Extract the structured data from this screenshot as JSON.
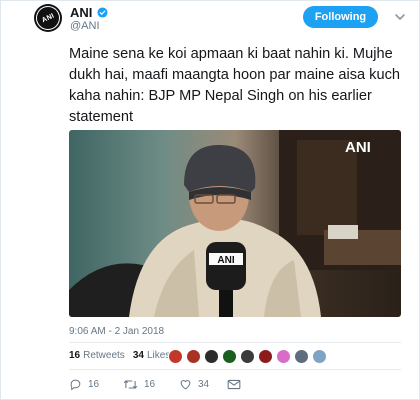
{
  "header": {
    "name": "ANI",
    "handle": "@ANI",
    "follow_label": "Following",
    "avatar_text": "ANI"
  },
  "tweet": {
    "text": "Maine sena ke koi apmaan ki baat nahin ki. Mujhe dukh hai, maafi maangta hoon par maine aisa kuch kaha nahin: BJP MP Nepal Singh on his earlier statement",
    "timestamp": "9:06 AM - 2 Jan 2018"
  },
  "media": {
    "watermark": "ANI",
    "mic_label": "ANI"
  },
  "stats": {
    "retweets_count": "16",
    "retweets_label": "Retweets",
    "likes_count": "34",
    "likes_label": "Likes"
  },
  "liker_avatar_colors": [
    "#c0392b",
    "#a93226",
    "#2c2c2c",
    "#1b5e20",
    "#3b3b3b",
    "#8e1b1b",
    "#d96bc9",
    "#5d6d7e",
    "#7fa3c5"
  ],
  "actions": {
    "reply_count": "16",
    "retweet_count": "16",
    "like_count": "34"
  },
  "colors": {
    "accent": "#1da1f2",
    "text_secondary": "#657786"
  },
  "icons": {
    "verified": "verified-badge-icon",
    "caret": "chevron-down-icon",
    "reply": "reply-icon",
    "retweet": "retweet-icon",
    "like": "heart-icon",
    "dm": "envelope-icon"
  }
}
